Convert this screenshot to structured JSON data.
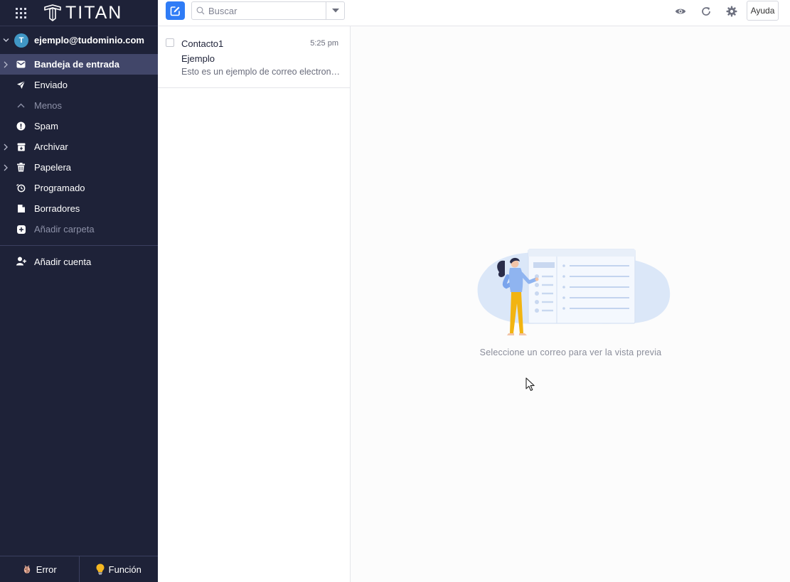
{
  "brand": {
    "name": "TITAN"
  },
  "account": {
    "initial": "T",
    "email": "ejemplo@tudominio.com"
  },
  "folders": [
    {
      "label": "Bandeja de entrada",
      "icon": "inbox-icon",
      "has_caret": true,
      "active": true
    },
    {
      "label": "Enviado",
      "icon": "send-icon",
      "has_caret": false
    },
    {
      "label": "Menos",
      "icon": "chevron-up-icon",
      "has_caret": false,
      "muted": true
    },
    {
      "label": "Spam",
      "icon": "spam-icon",
      "has_caret": false
    },
    {
      "label": "Archivar",
      "icon": "archive-icon",
      "has_caret": true
    },
    {
      "label": "Papelera",
      "icon": "trash-icon",
      "has_caret": true
    },
    {
      "label": "Programado",
      "icon": "clock-icon",
      "has_caret": false
    },
    {
      "label": "Borradores",
      "icon": "drafts-icon",
      "has_caret": false
    },
    {
      "label": "Añadir carpeta",
      "icon": "add-folder-icon",
      "has_caret": false,
      "muted": true
    }
  ],
  "add_account": {
    "label": "Añadir cuenta"
  },
  "bottom": {
    "error_label": "Error",
    "feature_label": "Función"
  },
  "toolbar": {
    "search_placeholder": "Buscar",
    "help_label": "Ayuda"
  },
  "messages": [
    {
      "from": "Contacto1",
      "time": "5:25 pm",
      "subject": "Ejemplo",
      "preview": "Esto es un ejemplo de correo electronico"
    }
  ],
  "preview_pane": {
    "empty_text": "Seleccione un correo para ver la vista previa"
  },
  "colors": {
    "sidebar_bg": "#1e2238",
    "active_bg": "#414669",
    "accent": "#2f7cf6",
    "avatar": "#4097c5"
  }
}
